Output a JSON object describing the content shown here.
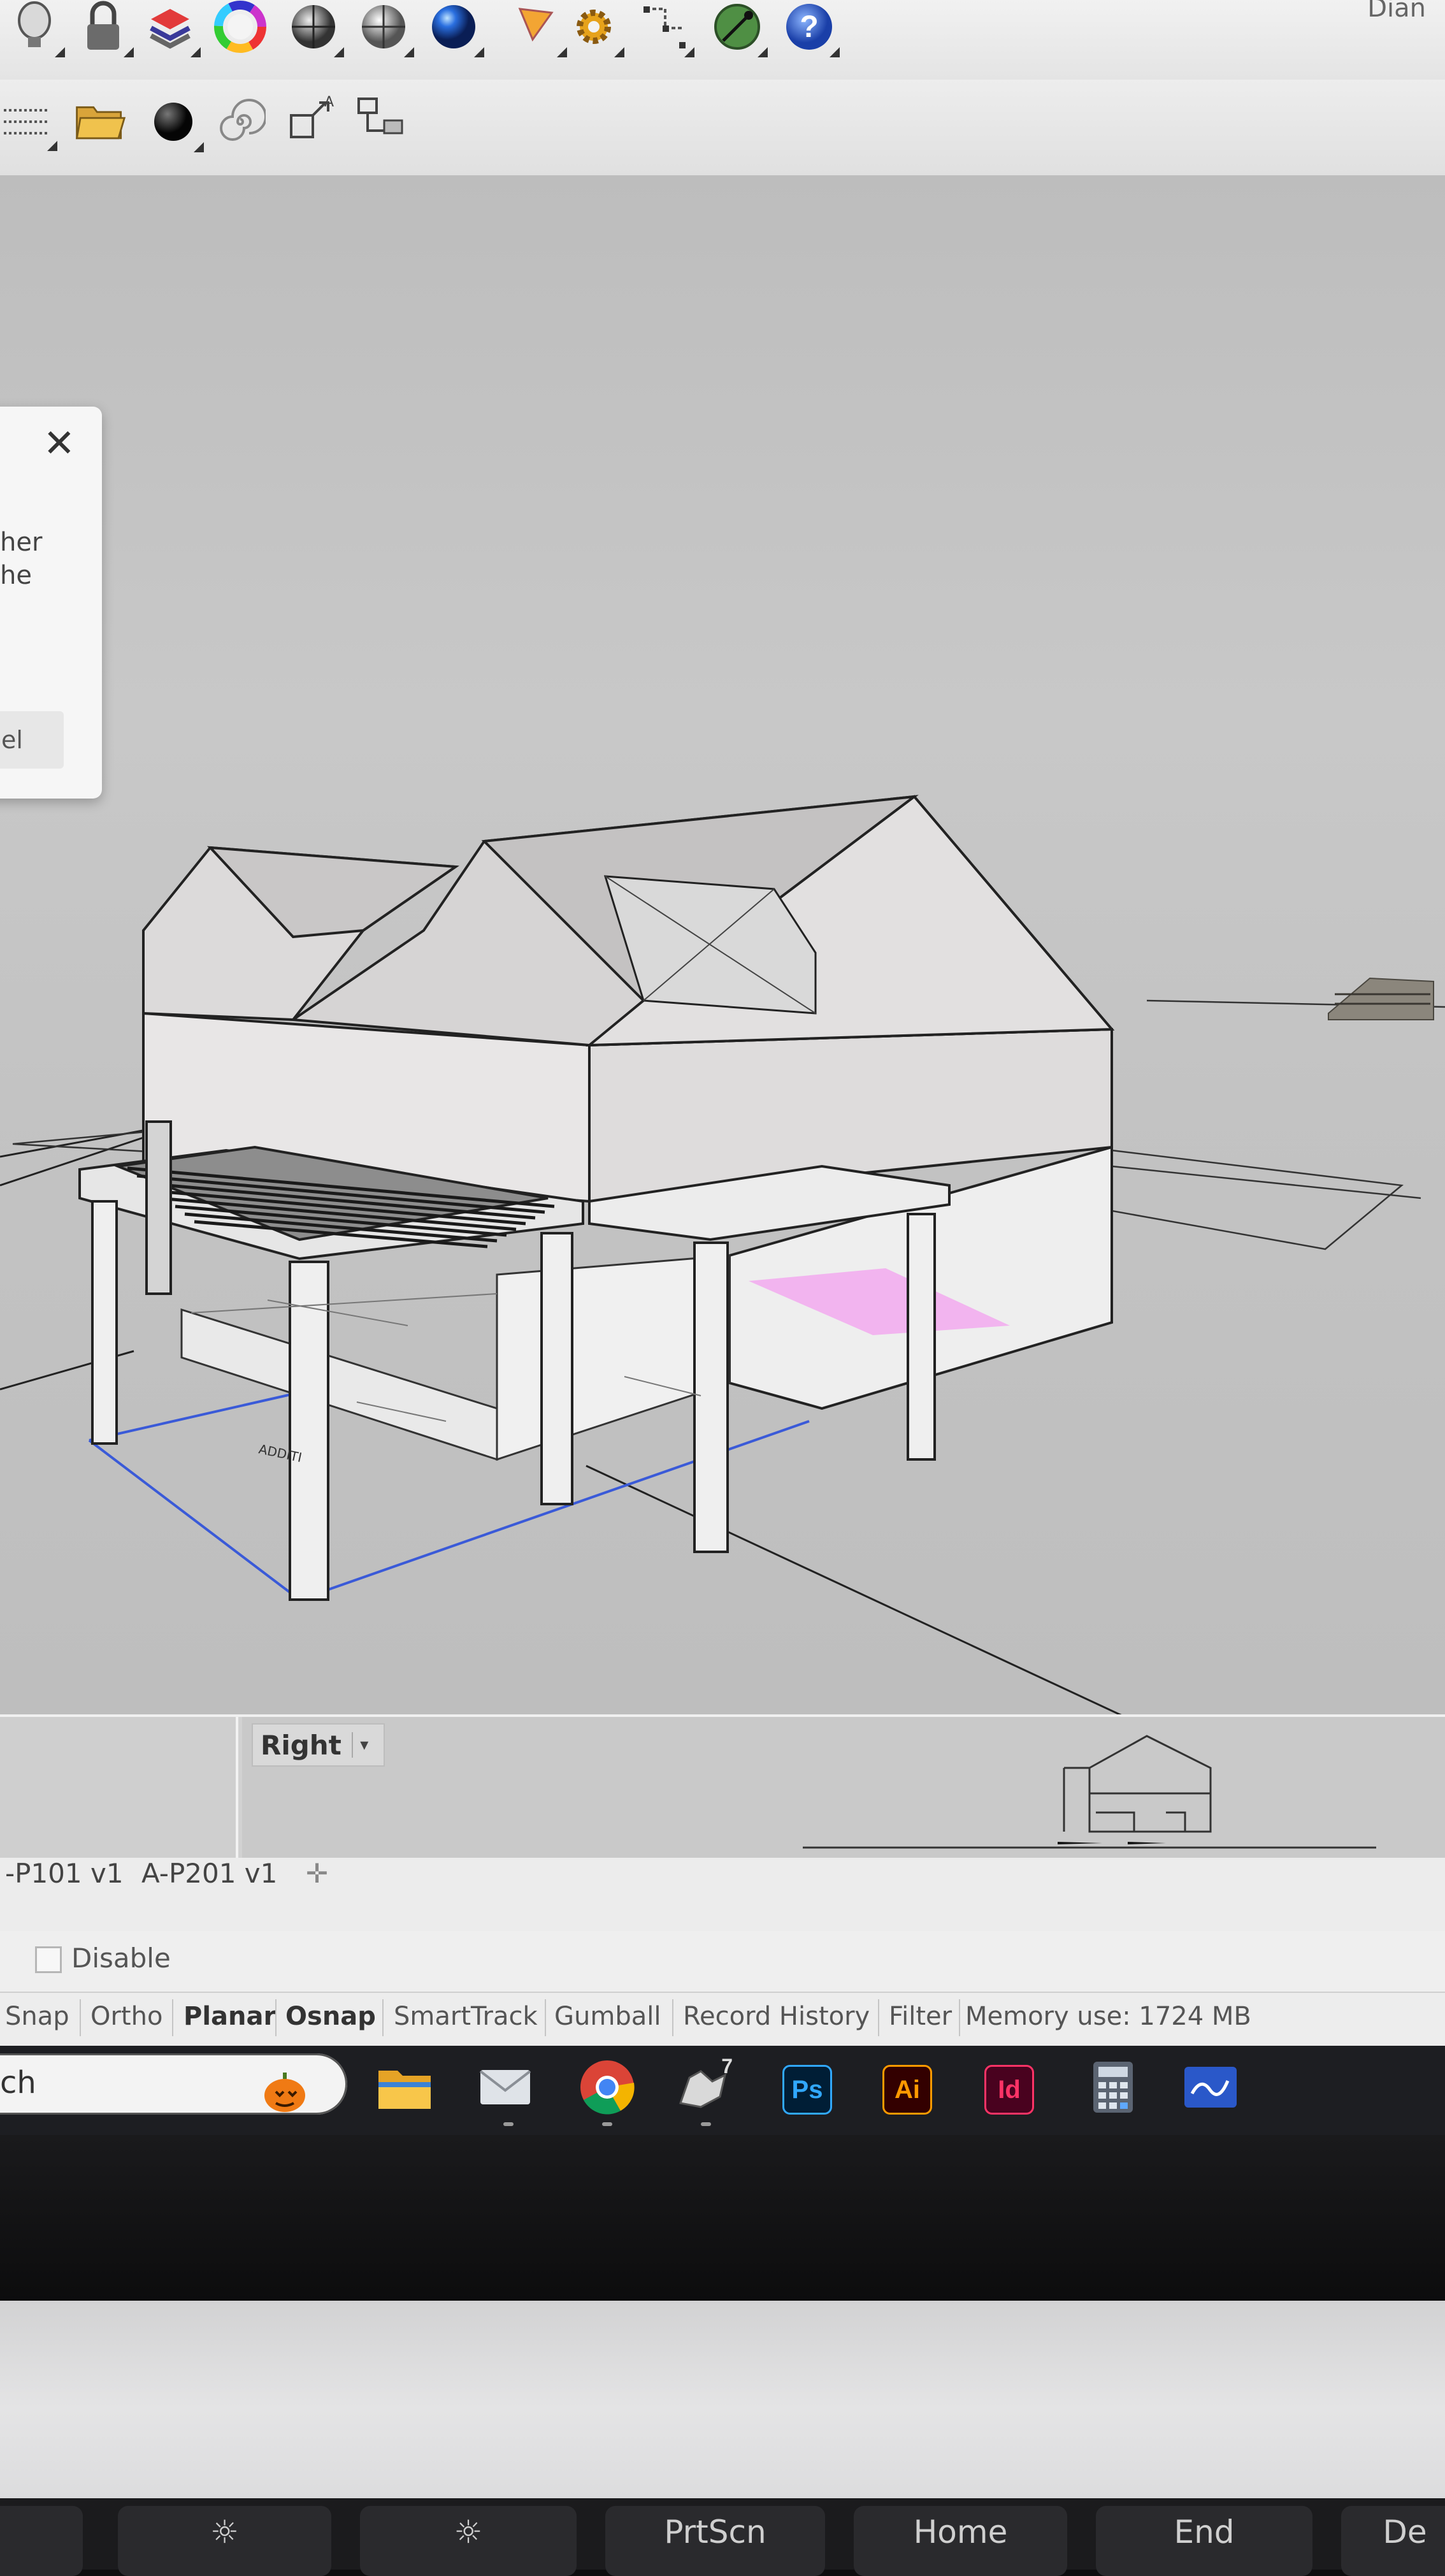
{
  "toolbar": {
    "corner_text": "Dian",
    "top_icons": [
      {
        "name": "lightbulb-icon"
      },
      {
        "name": "lock-icon"
      },
      {
        "name": "layer-stack-icon"
      },
      {
        "name": "color-wheel-icon"
      },
      {
        "name": "wireframe-sphere-icon"
      },
      {
        "name": "shaded-sphere-icon"
      },
      {
        "name": "rendered-sphere-icon"
      },
      {
        "name": "spotlight-icon"
      },
      {
        "name": "gear-settings-icon"
      },
      {
        "name": "snap-points-icon"
      },
      {
        "name": "globe-cursor-icon"
      },
      {
        "name": "help-icon",
        "glyph": "?"
      }
    ],
    "second_icons": [
      {
        "name": "properties-list-icon"
      },
      {
        "name": "open-folder-icon"
      },
      {
        "name": "material-ball-icon"
      },
      {
        "name": "spiral-icon"
      },
      {
        "name": "dimension-icon"
      },
      {
        "name": "text-dimension-icon"
      }
    ]
  },
  "dialog": {
    "close_glyph": "✕",
    "line1": "her",
    "line2": "he",
    "button_label": "el"
  },
  "viewport": {
    "label": "Right",
    "dropdown_glyph": "▾",
    "model_label_left": "ADDITI",
    "highlight_color": "#f2a9ee",
    "selection_color": "#3a5ad8"
  },
  "layouts": {
    "tabs": [
      "-P101 v1",
      "A-P201 v1"
    ],
    "add_glyph": "✛",
    "disable_label": "Disable"
  },
  "status_bar": {
    "items": [
      {
        "label": "Snap",
        "bold": false,
        "active": false
      },
      {
        "label": "Ortho",
        "bold": false,
        "active": false
      },
      {
        "label": "Planar",
        "bold": true,
        "active": true
      },
      {
        "label": "Osnap",
        "bold": true,
        "active": true
      },
      {
        "label": "SmartTrack",
        "bold": false,
        "active": false
      },
      {
        "label": "Gumball",
        "bold": false,
        "active": false
      },
      {
        "label": "Record History",
        "bold": false,
        "active": false
      },
      {
        "label": "Filter",
        "bold": false,
        "active": false
      }
    ],
    "memory": "Memory use: 1724 MB"
  },
  "taskbar": {
    "search_text": "ch",
    "apps": [
      {
        "name": "pumpkin-icon"
      },
      {
        "name": "file-explorer-icon"
      },
      {
        "name": "mail-icon"
      },
      {
        "name": "chrome-icon"
      },
      {
        "name": "rhino-7-icon",
        "label": "7"
      },
      {
        "name": "photoshop-icon",
        "label": "Ps",
        "bg": "#001e36",
        "fg": "#31a8ff"
      },
      {
        "name": "illustrator-icon",
        "label": "Ai",
        "bg": "#330000",
        "fg": "#ff9a00"
      },
      {
        "name": "indesign-icon",
        "label": "Id",
        "bg": "#49021f",
        "fg": "#ff3366"
      },
      {
        "name": "calculator-icon"
      },
      {
        "name": "whiteboard-icon"
      }
    ]
  },
  "keyboard": {
    "keys": [
      "",
      "☼",
      "☼",
      "PrtScn",
      "Home",
      "End",
      "De"
    ]
  }
}
